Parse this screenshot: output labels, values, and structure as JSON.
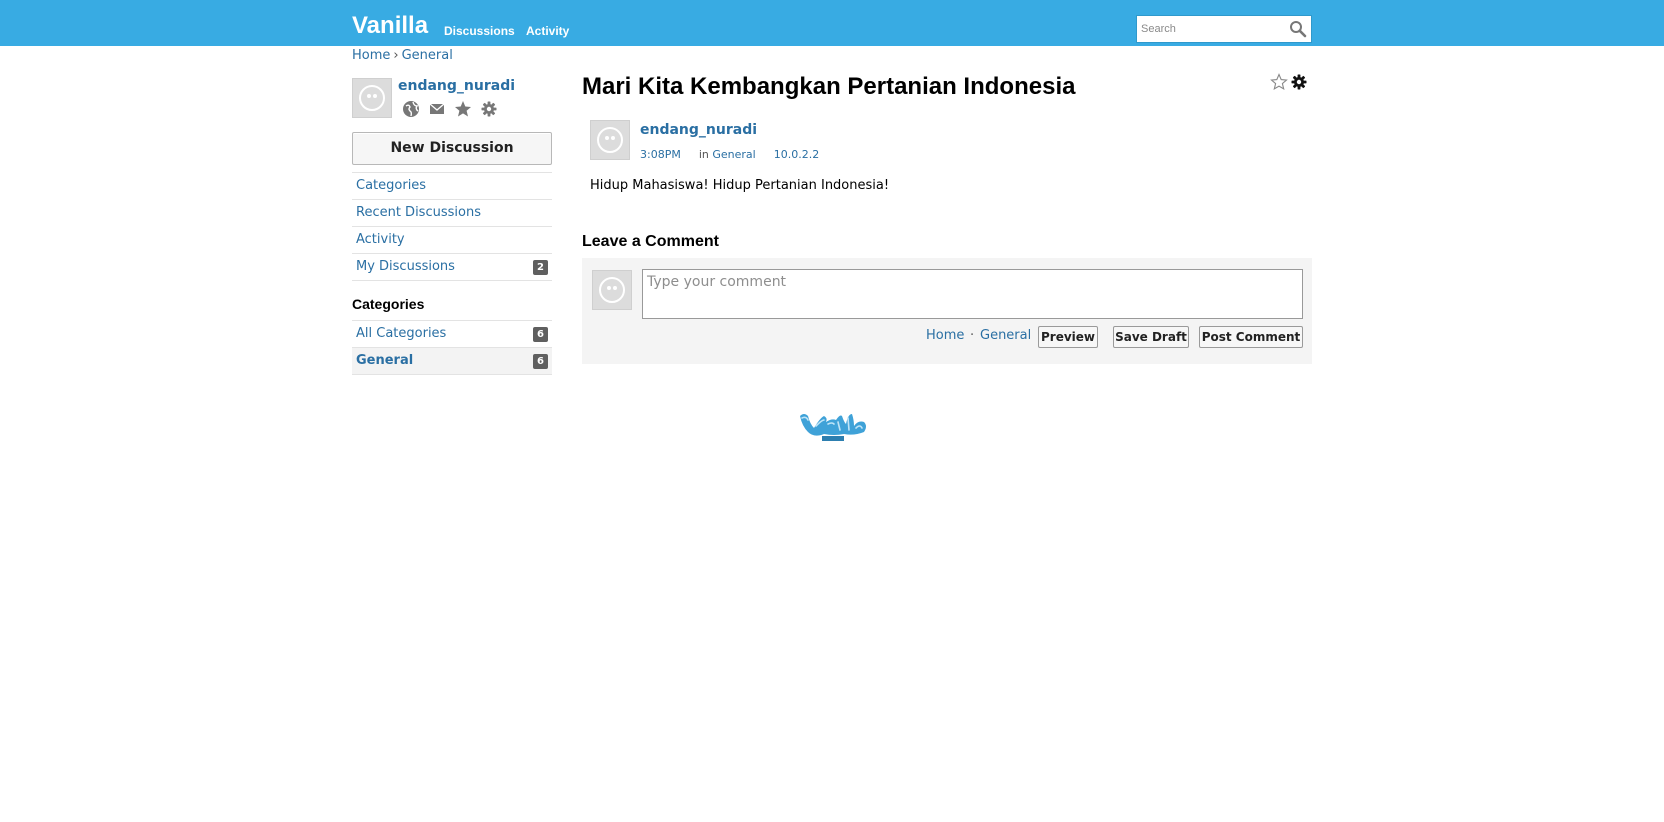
{
  "header": {
    "brand": "Vanilla",
    "nav": [
      "Discussions",
      "Activity"
    ],
    "search": {
      "placeholder": "Search",
      "value": ""
    }
  },
  "breadcrumb": {
    "home": "Home",
    "separator": "›",
    "current": "General"
  },
  "me": {
    "username": "endang_nuradi",
    "icons": [
      "dashboard-icon",
      "inbox-icon",
      "bookmarks-icon",
      "settings-icon"
    ]
  },
  "sidebar": {
    "new_discussion": "New Discussion",
    "nav_items": [
      {
        "label": "Categories",
        "count": ""
      },
      {
        "label": "Recent Discussions",
        "count": ""
      },
      {
        "label": "Activity",
        "count": ""
      },
      {
        "label": "My Discussions",
        "count": "2"
      }
    ],
    "categories_heading": "Categories",
    "categories": [
      {
        "label": "All Categories",
        "count": "6",
        "active": false
      },
      {
        "label": "General",
        "count": "6",
        "active": true
      }
    ]
  },
  "discussion": {
    "title": "Mari Kita Kembangkan Pertanian Indonesia",
    "author": "endang_nuradi",
    "time": "3:08PM",
    "in_prefix": "in",
    "category": "General",
    "ip": "10.0.2.2",
    "body": "Hidup Mahasiswa! Hidup Pertanian Indonesia!"
  },
  "comment": {
    "heading": "Leave a Comment",
    "placeholder": "Type your comment",
    "value": "",
    "crumb_home": "Home",
    "crumb_dot": "·",
    "crumb_category": "General",
    "preview": "Preview",
    "save_draft": "Save Draft",
    "post": "Post Comment"
  },
  "colors": {
    "header_bg": "#38abe3",
    "link": "#2a6fa3",
    "count_badge": "#5f5f5f"
  }
}
